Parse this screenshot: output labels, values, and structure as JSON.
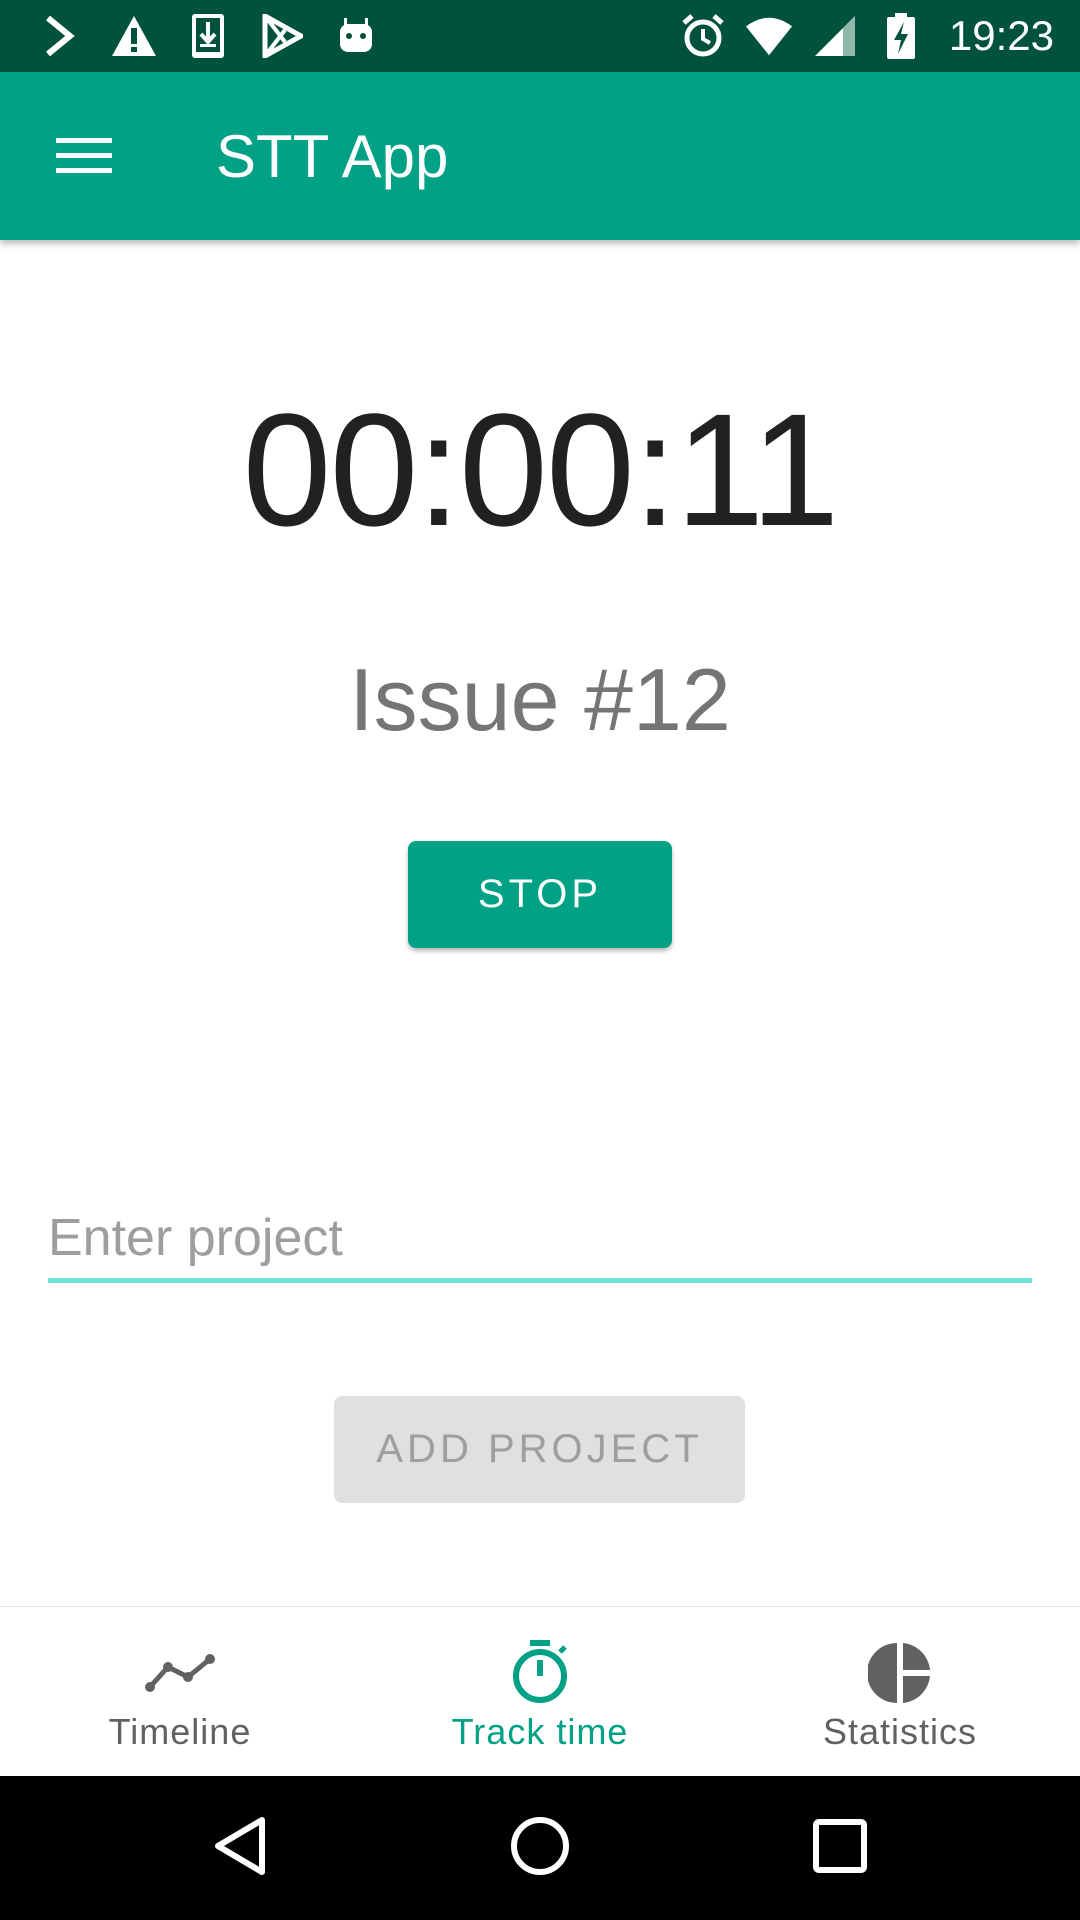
{
  "status_bar": {
    "time": "19:23",
    "left_icons": [
      "chevron-right-icon",
      "warning-icon",
      "download-icon",
      "play-store-icon",
      "android-icon"
    ],
    "right_icons": [
      "alarm-icon",
      "wifi-icon",
      "cell-signal-icon",
      "battery-charging-icon"
    ]
  },
  "app_bar": {
    "title": "STT App",
    "menu_icon": "hamburger-menu-icon"
  },
  "timer": {
    "elapsed": "00:00:11"
  },
  "current_task": {
    "name": "Issue #12"
  },
  "actions": {
    "stop_label": "STOP",
    "add_project_label": "ADD PROJECT"
  },
  "project_input": {
    "placeholder": "Enter project",
    "value": ""
  },
  "bottom_nav": {
    "items": [
      {
        "label": "Timeline",
        "icon": "timeline-icon",
        "active": false
      },
      {
        "label": "Track time",
        "icon": "stopwatch-icon",
        "active": true
      },
      {
        "label": "Statistics",
        "icon": "pie-chart-icon",
        "active": false
      }
    ]
  },
  "system_nav": {
    "buttons": [
      "back-icon",
      "home-icon",
      "recents-icon"
    ]
  },
  "colors": {
    "status_bar": "#00523c",
    "primary": "#00a184",
    "accent_line": "#6ee3d6",
    "disabled_button": "#e0e0e0",
    "inactive_nav": "#616161"
  }
}
